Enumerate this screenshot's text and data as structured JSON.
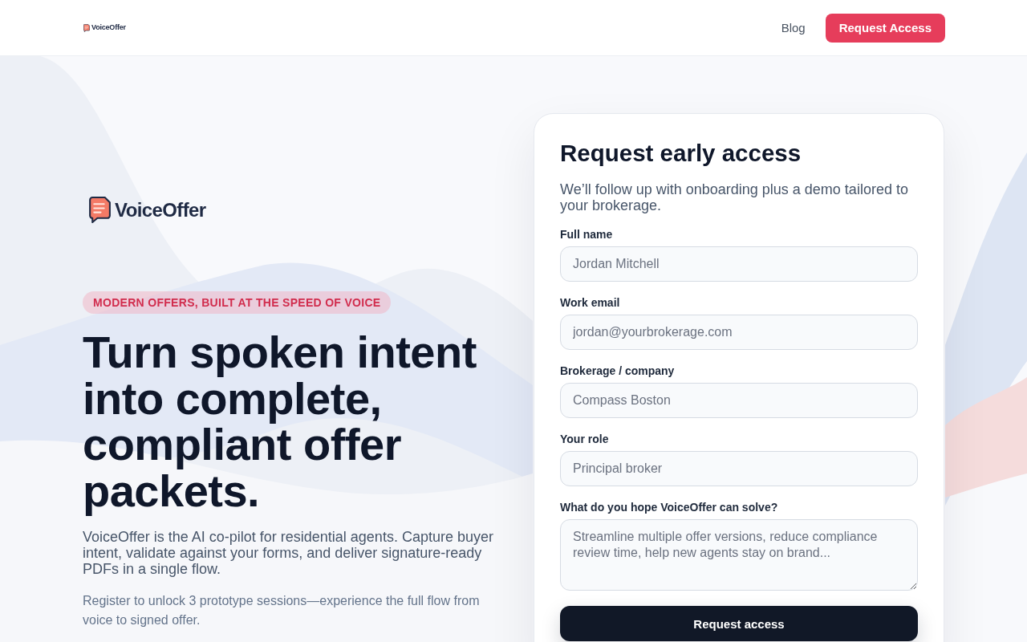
{
  "header": {
    "logo": {
      "text": "VoiceOffer"
    },
    "nav": [
      {
        "label": "Blog",
        "kind": "link"
      },
      {
        "label": "Request Access",
        "kind": "button"
      }
    ]
  },
  "hero": {
    "logo": {
      "text": "VoiceOffer"
    },
    "badge": "MODERN OFFERS, BUILT AT THE SPEED OF VOICE",
    "title": "Turn spoken intent into complete, compliant offer packets.",
    "description": "VoiceOffer is the AI co-pilot for residential agents. Capture buyer intent, validate against your forms, and deliver signature-ready PDFs in a single flow.",
    "note": "Register to unlock 3 prototype sessions—experience the full flow from voice to signed offer."
  },
  "form": {
    "title": "Request early access",
    "subtitle": "We’ll follow up with onboarding plus a demo tailored to your brokerage.",
    "fields": [
      {
        "label": "Full name",
        "placeholder": "Jordan Mitchell",
        "kind": "input"
      },
      {
        "label": "Work email",
        "placeholder": "jordan@yourbrokerage.com",
        "kind": "input"
      },
      {
        "label": "Brokerage / company",
        "placeholder": "Compass Boston",
        "kind": "input"
      },
      {
        "label": "Your role",
        "placeholder": "Principal broker",
        "kind": "input"
      },
      {
        "label": "What do you hope VoiceOffer can solve?",
        "placeholder": "Streamline multiple offer versions, reduce compliance review time, help new agents stay on brand...",
        "kind": "textarea"
      }
    ],
    "submit": "Request access"
  }
}
